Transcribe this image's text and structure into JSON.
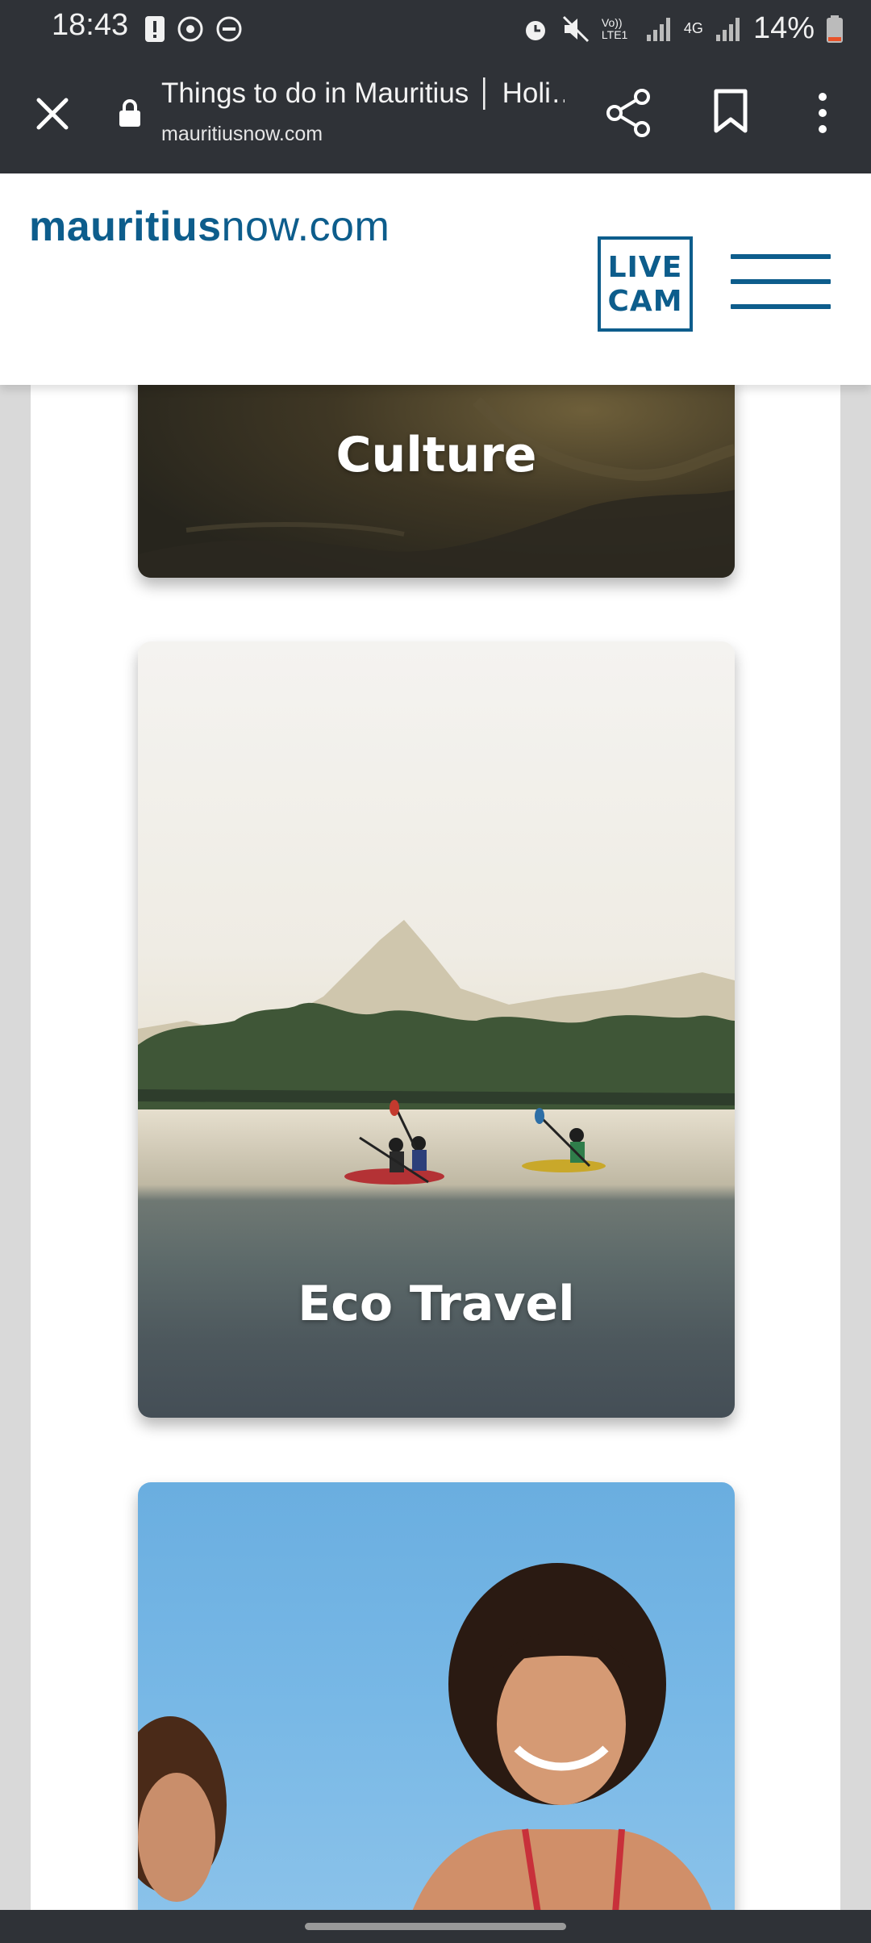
{
  "status_bar": {
    "time": "18:43",
    "battery_percent": "14%",
    "network_label": "4G",
    "volte_label": "Vo)) LTE1",
    "icons": [
      "alert-icon",
      "sync-icon",
      "dnd-icon",
      "alarm-icon",
      "mute-icon",
      "signal-icon",
      "battery-icon"
    ]
  },
  "browser": {
    "page_title": "Things to do in Mauritius │ Holi…",
    "url": "mauritiusnow.com",
    "icons": [
      "close-icon",
      "lock-icon",
      "share-icon",
      "bookmark-icon",
      "more-vert-icon"
    ]
  },
  "site": {
    "logo_bold": "mauritius",
    "logo_light": "now.com",
    "livecam_line1": "LIVE",
    "livecam_line2": "CAM",
    "brand_color": "#0d5d8c"
  },
  "cards": [
    {
      "label": "Culture"
    },
    {
      "label": "Eco Travel"
    },
    {
      "label": ""
    }
  ]
}
